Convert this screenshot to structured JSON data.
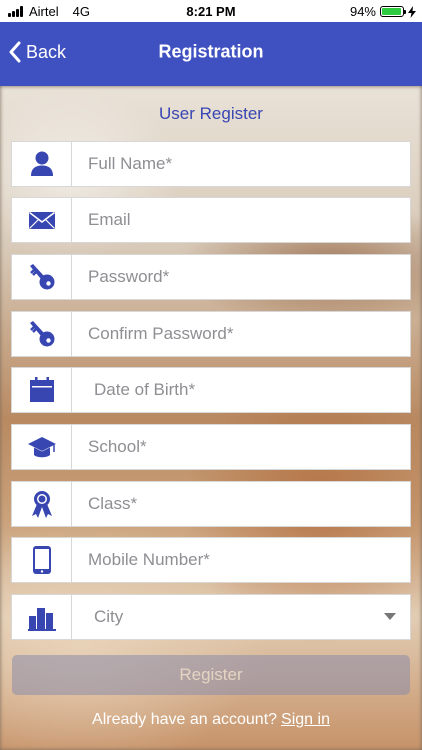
{
  "status_bar": {
    "carrier": "Airtel",
    "network": "4G",
    "time": "8:21 PM",
    "battery": "94%",
    "battery_level": 0.94
  },
  "nav": {
    "back_label": "Back",
    "title": "Registration"
  },
  "form": {
    "subtitle": "User Register",
    "fields": {
      "full_name": {
        "placeholder": "Full Name*",
        "icon": "user-icon"
      },
      "email": {
        "placeholder": "Email",
        "icon": "envelope-icon"
      },
      "password": {
        "placeholder": "Password*",
        "icon": "key-icon"
      },
      "confirm_password": {
        "placeholder": "Confirm Password*",
        "icon": "key-icon"
      },
      "dob": {
        "placeholder": "Date of Birth*",
        "icon": "calendar-icon"
      },
      "school": {
        "placeholder": "School*",
        "icon": "graduation-cap-icon"
      },
      "class": {
        "placeholder": "Class*",
        "icon": "award-ribbon-icon"
      },
      "mobile": {
        "placeholder": "Mobile Number*",
        "icon": "mobile-phone-icon"
      },
      "city": {
        "value": "City",
        "icon": "city-buildings-icon"
      }
    },
    "register_label": "Register",
    "signin_prompt": "Already have an account?",
    "signin_link": "Sign in"
  },
  "colors": {
    "accent": "#3f51c1",
    "icon": "#3846b2"
  }
}
